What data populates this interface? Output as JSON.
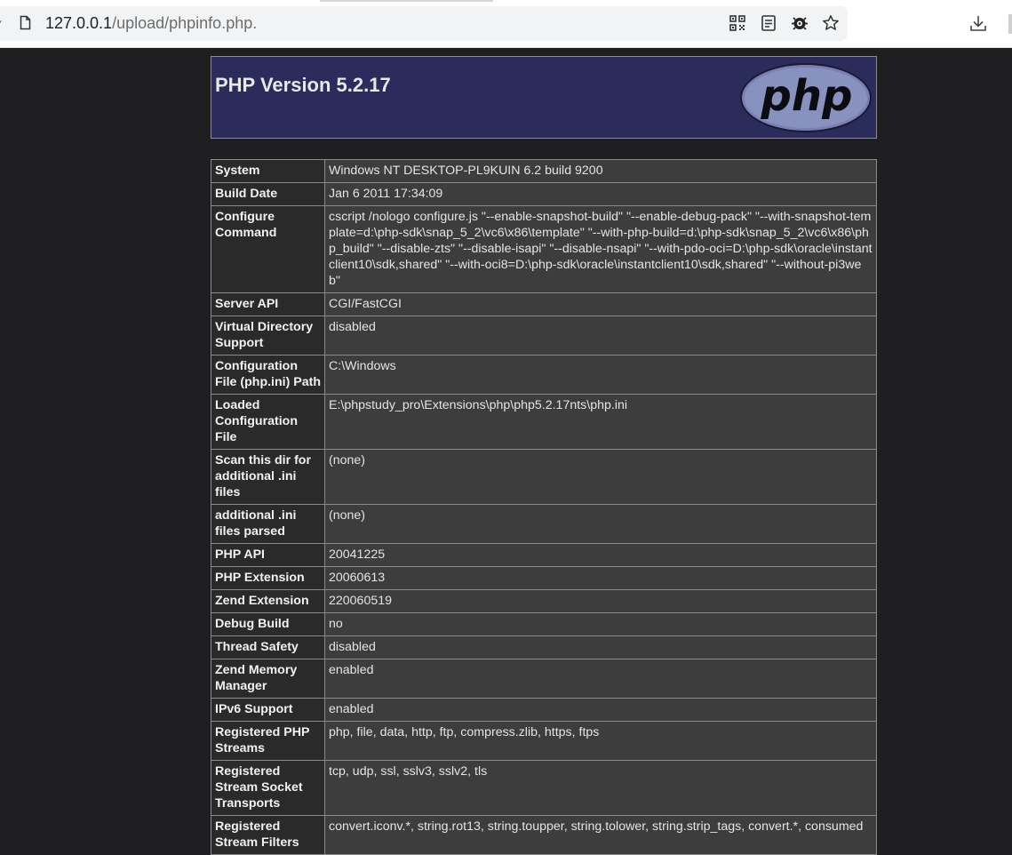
{
  "browser": {
    "url_host": "127.0.0.1",
    "url_path": "/upload/phpinfo.php.",
    "toolbar_icons": [
      "qr-code-icon",
      "reader-mode-icon",
      "bug-icon",
      "bookmark-star-icon",
      "download-icon"
    ]
  },
  "page": {
    "title": "PHP Version 5.2.17",
    "logo_text": "php",
    "colors": {
      "header_bg": "#2b2b5c",
      "label_cell_bg": "#2a2a2a",
      "value_cell_bg": "#3d3d3d",
      "page_bg": "#1f1f22"
    },
    "rows": [
      {
        "label": "System",
        "value": "Windows NT DESKTOP-PL9KUIN 6.2 build 9200"
      },
      {
        "label": "Build Date",
        "value": "Jan 6 2011 17:34:09"
      },
      {
        "label": "Configure Command",
        "value": "cscript /nologo configure.js \"--enable-snapshot-build\" \"--enable-debug-pack\" \"--with-snapshot-template=d:\\php-sdk\\snap_5_2\\vc6\\x86\\template\" \"--with-php-build=d:\\php-sdk\\snap_5_2\\vc6\\x86\\php_build\" \"--disable-zts\" \"--disable-isapi\" \"--disable-nsapi\" \"--with-pdo-oci=D:\\php-sdk\\oracle\\instantclient10\\sdk,shared\" \"--with-oci8=D:\\php-sdk\\oracle\\instantclient10\\sdk,shared\" \"--without-pi3web\""
      },
      {
        "label": "Server API",
        "value": "CGI/FastCGI"
      },
      {
        "label": "Virtual Directory Support",
        "value": "disabled"
      },
      {
        "label": "Configuration File (php.ini) Path",
        "value": "C:\\Windows"
      },
      {
        "label": "Loaded Configuration File",
        "value": "E:\\phpstudy_pro\\Extensions\\php\\php5.2.17nts\\php.ini"
      },
      {
        "label": "Scan this dir for additional .ini files",
        "value": "(none)"
      },
      {
        "label": "additional .ini files parsed",
        "value": "(none)"
      },
      {
        "label": "PHP API",
        "value": "20041225"
      },
      {
        "label": "PHP Extension",
        "value": "20060613"
      },
      {
        "label": "Zend Extension",
        "value": "220060519"
      },
      {
        "label": "Debug Build",
        "value": "no"
      },
      {
        "label": "Thread Safety",
        "value": "disabled"
      },
      {
        "label": "Zend Memory Manager",
        "value": "enabled"
      },
      {
        "label": "IPv6 Support",
        "value": "enabled"
      },
      {
        "label": "Registered PHP Streams",
        "value": "php, file, data, http, ftp, compress.zlib, https, ftps"
      },
      {
        "label": "Registered Stream Socket Transports",
        "value": "tcp, udp, ssl, sslv3, sslv2, tls"
      },
      {
        "label": "Registered Stream Filters",
        "value": "convert.iconv.*, string.rot13, string.toupper, string.tolower, string.strip_tags, convert.*, consumed"
      }
    ]
  }
}
